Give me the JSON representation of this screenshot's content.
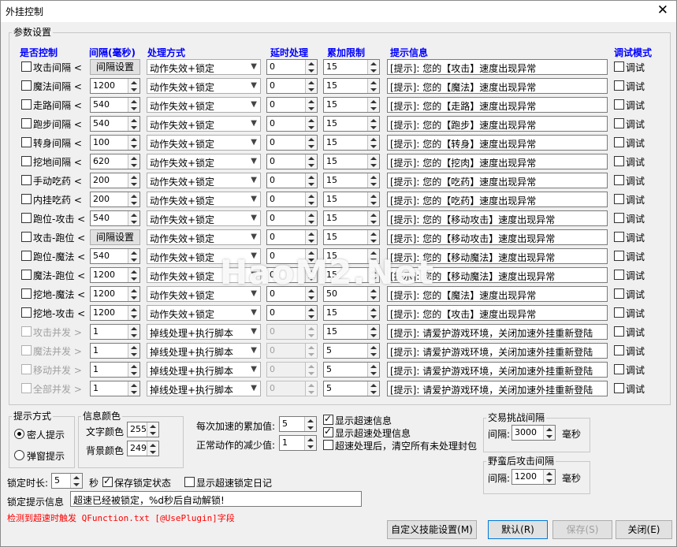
{
  "window": {
    "title": "外挂控制",
    "close_glyph": "✕"
  },
  "params_group": {
    "label": "参数设置"
  },
  "headers": {
    "control": "是否控制",
    "interval": "间隔(毫秒)",
    "method": "处理方式",
    "delay": "延时处理",
    "limit": "累加限制",
    "tip": "提示信息",
    "debug": "调试模式"
  },
  "rows": [
    {
      "label": "攻击间隔 <",
      "checked": false,
      "disabled": false,
      "interval_button": "间隔设置",
      "method": "动作失效+锁定",
      "delay": "0",
      "limit": "15",
      "tip": "[提示]: 您的【攻击】速度出现异常",
      "debug_label": "调试",
      "debug_checked": false
    },
    {
      "label": "魔法间隔 <",
      "checked": false,
      "disabled": false,
      "interval": "1200",
      "method": "动作失效+锁定",
      "delay": "0",
      "limit": "15",
      "tip": "[提示]: 您的【魔法】速度出现异常",
      "debug_label": "调试",
      "debug_checked": false
    },
    {
      "label": "走路间隔 <",
      "checked": false,
      "disabled": false,
      "interval": "540",
      "method": "动作失效+锁定",
      "delay": "0",
      "limit": "15",
      "tip": "[提示]: 您的【走路】速度出现异常",
      "debug_label": "调试",
      "debug_checked": false
    },
    {
      "label": "跑步间隔 <",
      "checked": false,
      "disabled": false,
      "interval": "540",
      "method": "动作失效+锁定",
      "delay": "0",
      "limit": "15",
      "tip": "[提示]: 您的【跑步】速度出现异常",
      "debug_label": "调试",
      "debug_checked": false
    },
    {
      "label": "转身间隔 <",
      "checked": false,
      "disabled": false,
      "interval": "100",
      "method": "动作失效+锁定",
      "delay": "0",
      "limit": "15",
      "tip": "[提示]: 您的【转身】速度出现异常",
      "debug_label": "调试",
      "debug_checked": false
    },
    {
      "label": "挖地间隔 <",
      "checked": false,
      "disabled": false,
      "interval": "620",
      "method": "动作失效+锁定",
      "delay": "0",
      "limit": "15",
      "tip": "[提示]: 您的【挖肉】速度出现异常",
      "debug_label": "调试",
      "debug_checked": false
    },
    {
      "label": "手动吃药 <",
      "checked": false,
      "disabled": false,
      "interval": "200",
      "method": "动作失效+锁定",
      "delay": "0",
      "limit": "15",
      "tip": "[提示]: 您的【吃药】速度出现异常",
      "debug_label": "调试",
      "debug_checked": false
    },
    {
      "label": "内挂吃药 <",
      "checked": false,
      "disabled": false,
      "interval": "200",
      "method": "动作失效+锁定",
      "delay": "0",
      "limit": "15",
      "tip": "[提示]: 您的【吃药】速度出现异常",
      "debug_label": "调试",
      "debug_checked": false
    },
    {
      "label": "跑位-攻击 <",
      "checked": false,
      "disabled": false,
      "interval": "540",
      "method": "动作失效+锁定",
      "delay": "0",
      "limit": "15",
      "tip": "[提示]: 您的【移动攻击】速度出现异常",
      "debug_label": "调试",
      "debug_checked": false
    },
    {
      "label": "攻击-跑位 <",
      "checked": false,
      "disabled": false,
      "interval_button": "间隔设置",
      "method": "动作失效+锁定",
      "delay": "0",
      "limit": "15",
      "tip": "[提示]: 您的【移动攻击】速度出现异常",
      "debug_label": "调试",
      "debug_checked": false
    },
    {
      "label": "跑位-魔法 <",
      "checked": false,
      "disabled": false,
      "interval": "540",
      "method": "动作失效+锁定",
      "delay": "0",
      "limit": "15",
      "tip": "[提示]: 您的【移动魔法】速度出现异常",
      "debug_label": "调试",
      "debug_checked": false
    },
    {
      "label": "魔法-跑位 <",
      "checked": false,
      "disabled": false,
      "interval": "1200",
      "method": "动作失效+锁定",
      "delay": "0",
      "limit": "15",
      "tip": "[提示]: 您的【移动魔法】速度出现异常",
      "debug_label": "调试",
      "debug_checked": false
    },
    {
      "label": "挖地-魔法 <",
      "checked": false,
      "disabled": false,
      "interval": "1200",
      "method": "动作失效+锁定",
      "delay": "0",
      "limit": "50",
      "tip": "[提示]: 您的【魔法】速度出现异常",
      "debug_label": "调试",
      "debug_checked": false
    },
    {
      "label": "挖地-攻击 <",
      "checked": false,
      "disabled": false,
      "interval": "1200",
      "method": "动作失效+锁定",
      "delay": "0",
      "limit": "15",
      "tip": "[提示]: 您的【攻击】速度出现异常",
      "debug_label": "调试",
      "debug_checked": false
    },
    {
      "label": "攻击并发 >",
      "checked": false,
      "disabled": true,
      "interval": "1",
      "method": "掉线处理+执行脚本",
      "delay": "0",
      "limit": "15",
      "tip": "[提示]: 请爱护游戏环境，关闭加速外挂重新登陆",
      "debug_label": "调试",
      "debug_checked": false
    },
    {
      "label": "魔法并发 >",
      "checked": false,
      "disabled": true,
      "interval": "1",
      "method": "掉线处理+执行脚本",
      "delay": "0",
      "limit": "5",
      "tip": "[提示]: 请爱护游戏环境，关闭加速外挂重新登陆",
      "debug_label": "调试",
      "debug_checked": false
    },
    {
      "label": "移动并发 >",
      "checked": false,
      "disabled": true,
      "interval": "1",
      "method": "掉线处理+执行脚本",
      "delay": "0",
      "limit": "5",
      "tip": "[提示]: 请爱护游戏环境，关闭加速外挂重新登陆",
      "debug_label": "调试",
      "debug_checked": false
    },
    {
      "label": "全部并发 >",
      "checked": false,
      "disabled": true,
      "interval": "1",
      "method": "掉线处理+执行脚本",
      "delay": "0",
      "limit": "5",
      "tip": "[提示]: 请爱护游戏环境，关闭加速外挂重新登陆",
      "debug_label": "调试",
      "debug_checked": false
    }
  ],
  "prompt_mode": {
    "label": "提示方式",
    "option_secret": "密人提示",
    "option_popup": "弹窗提示",
    "selected": "secret"
  },
  "info_color": {
    "label": "信息颜色",
    "text_color_label": "文字颜色",
    "text_color_value": "255",
    "bg_color_label": "背景颜色",
    "bg_color_value": "249"
  },
  "accel": {
    "increment_label": "每次加速的累加值:",
    "increment_value": "5",
    "decrement_label": "正常动作的减少值:",
    "decrement_value": "1"
  },
  "checkboxes": {
    "show_speed_info": "显示超速信息",
    "show_speed_handling": "显示超速处理信息",
    "clear_after": "超速处理后，清空所有未处理封包"
  },
  "trade_group": {
    "label": "交易挑战间隔",
    "interval_label": "间隔:",
    "interval_value": "3000",
    "unit": "毫秒"
  },
  "savage_group": {
    "label": "野蛮后攻击间隔",
    "interval_label": "间隔:",
    "interval_value": "1200",
    "unit": "毫秒"
  },
  "lock": {
    "duration_label": "锁定时长:",
    "duration_value": "5",
    "unit": "秒",
    "save_state_label": "保存锁定状态",
    "show_log_label": "显示超速锁定日记",
    "tip_label": "锁定提示信息",
    "tip_value": "超速已经被锁定，%d秒后自动解锁!"
  },
  "red_note": "检测到超速时触发 QFunction.txt [@UsePlugin]字段",
  "buttons": {
    "custom": "自定义技能设置(M)",
    "default": "默认(R)",
    "save": "保存(S)",
    "close": "关闭(E)"
  },
  "watermark": "HaoM2.Net"
}
